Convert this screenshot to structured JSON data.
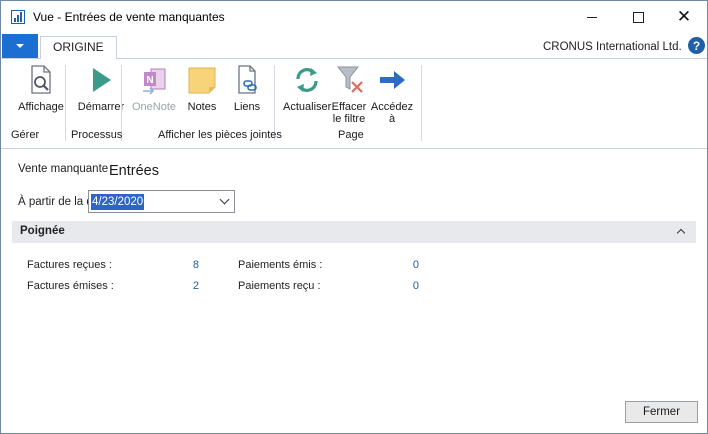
{
  "window": {
    "title": "Vue - Entrées de vente manquantes",
    "close_glyph": "✕"
  },
  "tabs": {
    "active": "ORIGINE"
  },
  "header": {
    "company": "CRONUS International Ltd.",
    "help_glyph": "?"
  },
  "ribbon": {
    "buttons": {
      "affichage": "Affichage",
      "demarrer": "Démarrer",
      "onenote": "OneNote",
      "notes": "Notes",
      "liens": "Liens",
      "actualiser": "Actualiser",
      "effacer_filtre_1": "Effacer",
      "effacer_filtre_2": "le filtre",
      "accedez_1": "Accédez",
      "accedez_2": "à"
    },
    "groups": {
      "gerer": "Gérer",
      "processus": "Processus",
      "pieces_jointes": "Afficher les pièces jointes",
      "page": "Page"
    }
  },
  "form": {
    "vente_label": "Vente manquante",
    "vente_value": "Entrées",
    "date_label": "À partir de la date",
    "date_value": "4/23/2020"
  },
  "section": {
    "title": "Poignée",
    "fields": [
      {
        "label": "Factures reçues :",
        "value": "8"
      },
      {
        "label": "Factures émises :",
        "value": "2"
      },
      {
        "label": "Paiements émis :",
        "value": "0"
      },
      {
        "label": "Paiements reçu :",
        "value": "0"
      }
    ]
  },
  "footer": {
    "close_label": "Fermer"
  },
  "colors": {
    "accent": "#1a6fd1",
    "link_value": "#1f5fa8",
    "section_bg": "#e7e9ed"
  }
}
